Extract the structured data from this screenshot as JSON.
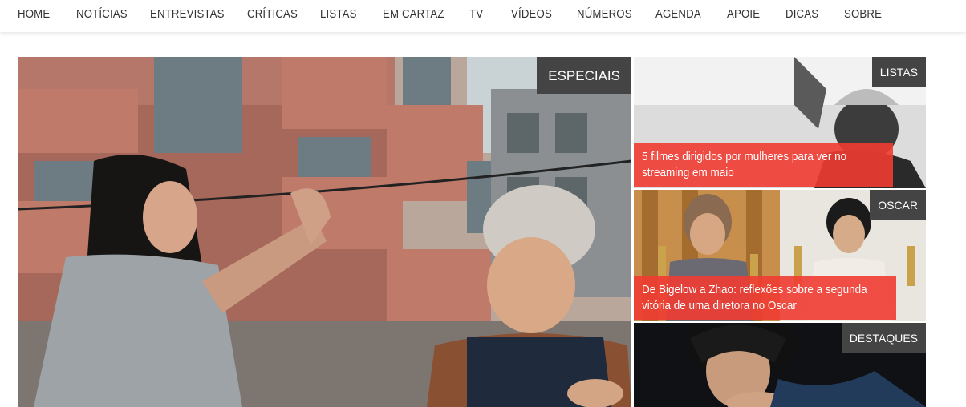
{
  "nav": {
    "items": [
      {
        "label": "HOME"
      },
      {
        "label": "NOTÍCIAS"
      },
      {
        "label": "ENTREVISTAS"
      },
      {
        "label": "CRÍTICAS"
      },
      {
        "label": "LISTAS"
      },
      {
        "label": "EM CARTAZ"
      },
      {
        "label": "TV"
      },
      {
        "label": "VÍDEOS"
      },
      {
        "label": "NÚMEROS"
      },
      {
        "label": "AGENDA"
      },
      {
        "label": "APOIE"
      },
      {
        "label": "DICAS"
      },
      {
        "label": "SOBRE"
      }
    ]
  },
  "featured": {
    "main": {
      "category": "ESPECIAIS"
    },
    "side": [
      {
        "category": "LISTAS",
        "title": "5 filmes dirigidos por mulheres para ver no streaming em maio"
      },
      {
        "category": "OSCAR",
        "title": "De Bigelow a Zhao: reflexões sobre a segunda vitória de uma diretora no Oscar"
      },
      {
        "category": "DESTAQUES"
      }
    ]
  },
  "colors": {
    "caption_bg": "#f03c32",
    "tag_bg": "#444444",
    "nav_text": "#333333"
  }
}
